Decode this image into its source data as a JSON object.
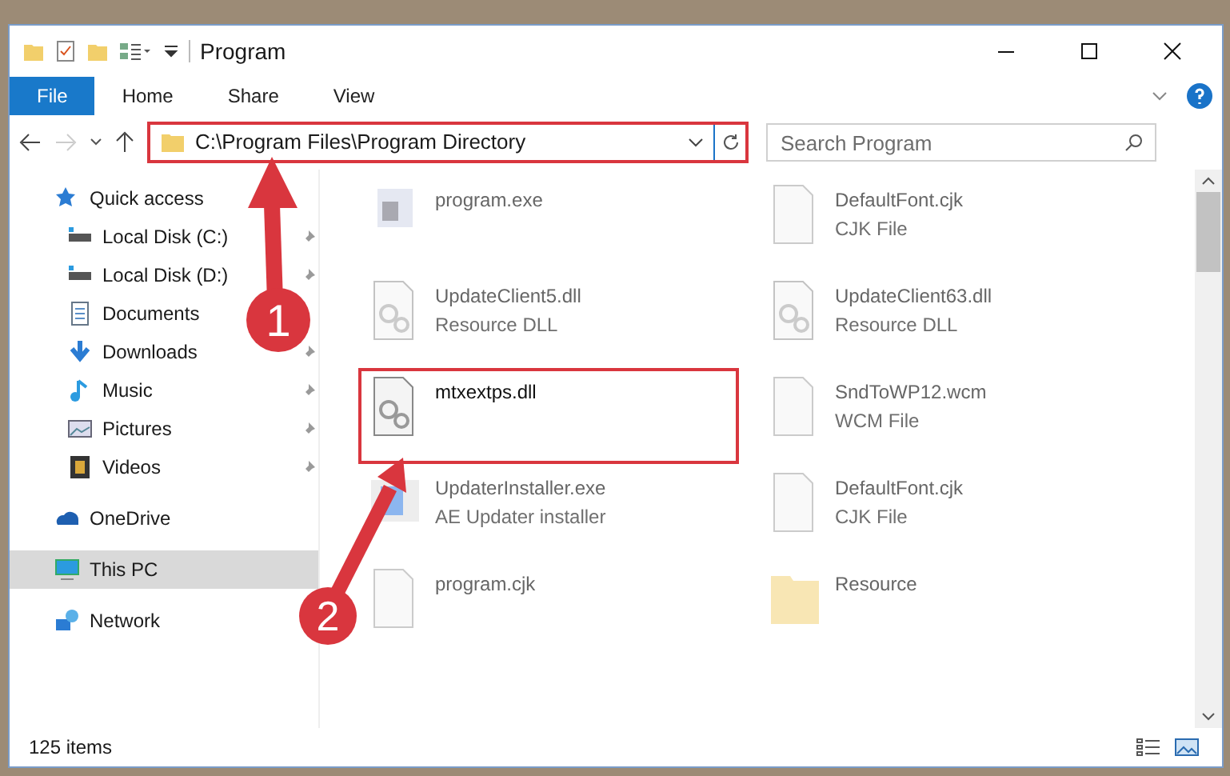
{
  "window": {
    "title": "Program"
  },
  "ribbon_tabs": [
    {
      "label": "File",
      "selected": true
    },
    {
      "label": "Home",
      "selected": false
    },
    {
      "label": "Share",
      "selected": false
    },
    {
      "label": "View",
      "selected": false
    }
  ],
  "address": {
    "path": "C:\\Program Files\\Program Directory",
    "highlighted": true
  },
  "search": {
    "placeholder": "Search Program"
  },
  "sidebar": {
    "items": [
      {
        "label": "Quick access",
        "kind": "star",
        "pinned": false,
        "selected": false,
        "children": [
          {
            "label": "Local Disk (C:)",
            "kind": "disk",
            "pinned": true,
            "selected": false
          },
          {
            "label": "Local Disk (D:)",
            "kind": "disk",
            "pinned": true,
            "selected": false
          },
          {
            "label": "Documents",
            "kind": "doc",
            "pinned": false,
            "selected": false
          },
          {
            "label": "Downloads",
            "kind": "download",
            "pinned": true,
            "selected": false
          },
          {
            "label": "Music",
            "kind": "music",
            "pinned": true,
            "selected": false
          },
          {
            "label": "Pictures",
            "kind": "picture",
            "pinned": true,
            "selected": false
          },
          {
            "label": "Videos",
            "kind": "video",
            "pinned": true,
            "selected": false
          }
        ]
      },
      {
        "label": "OneDrive",
        "kind": "cloud",
        "pinned": false,
        "selected": false
      },
      {
        "label": "This PC",
        "kind": "pc",
        "pinned": false,
        "selected": true
      },
      {
        "label": "Network",
        "kind": "network",
        "pinned": false,
        "selected": false
      }
    ]
  },
  "files": [
    {
      "name": "program.exe",
      "kind": "exe",
      "blurred": true,
      "highlighted": false
    },
    {
      "name": "DefaultFont.cjk",
      "type": "CJK File",
      "kind": "file",
      "blurred": true,
      "highlighted": false
    },
    {
      "name": "UpdateClient5.dll",
      "type": "Resource DLL",
      "kind": "dll",
      "blurred": true,
      "highlighted": false
    },
    {
      "name": "UpdateClient63.dll",
      "type": "Resource DLL",
      "kind": "dll",
      "blurred": true,
      "highlighted": false
    },
    {
      "name": "mtxextps.dll",
      "kind": "dll",
      "blurred": false,
      "highlighted": true
    },
    {
      "name": "SndToWP12.wcm",
      "type": "WCM File",
      "kind": "file",
      "blurred": true,
      "highlighted": false
    },
    {
      "name": "UpdaterInstaller.exe",
      "type": "AE Updater installer",
      "kind": "installer",
      "blurred": true,
      "highlighted": false
    },
    {
      "name": "DefaultFont.cjk",
      "type": "CJK File",
      "kind": "file",
      "blurred": true,
      "highlighted": false
    },
    {
      "name": "program.cjk",
      "kind": "file",
      "blurred": true,
      "highlighted": false
    },
    {
      "name": "Resource",
      "kind": "folder",
      "blurred": true,
      "highlighted": false
    }
  ],
  "callouts": [
    {
      "number": "1"
    },
    {
      "number": "2"
    }
  ],
  "status_bar": {
    "count": "125 items"
  }
}
